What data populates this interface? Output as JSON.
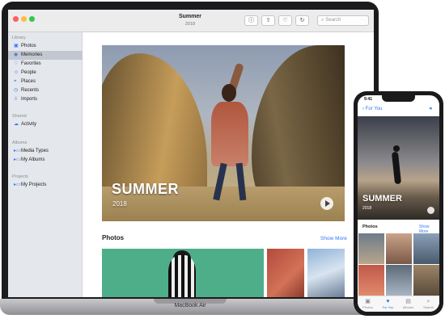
{
  "laptop": {
    "brand_label": "MacBook Air",
    "window": {
      "title": "Summer",
      "subtitle": "2018",
      "search_placeholder": "Search"
    },
    "sidebar": {
      "sections": [
        {
          "label": "Library",
          "items": [
            {
              "label": "Photos",
              "icon": "photos-icon",
              "selected": false
            },
            {
              "label": "Memories",
              "icon": "memories-icon",
              "selected": true
            },
            {
              "label": "Favorites",
              "icon": "heart-icon",
              "selected": false
            },
            {
              "label": "People",
              "icon": "people-icon",
              "selected": false
            },
            {
              "label": "Places",
              "icon": "places-icon",
              "selected": false
            },
            {
              "label": "Recents",
              "icon": "clock-icon",
              "selected": false
            },
            {
              "label": "Imports",
              "icon": "import-icon",
              "selected": false
            }
          ]
        },
        {
          "label": "Shared",
          "items": [
            {
              "label": "Activity",
              "icon": "cloud-icon",
              "selected": false
            }
          ]
        },
        {
          "label": "Albums",
          "items": [
            {
              "label": "Media Types",
              "icon": "folder-icon",
              "selected": false
            },
            {
              "label": "My Albums",
              "icon": "folder-icon",
              "selected": false
            }
          ]
        },
        {
          "label": "Projects",
          "items": [
            {
              "label": "My Projects",
              "icon": "folder-icon",
              "selected": false
            }
          ]
        }
      ]
    },
    "hero": {
      "title": "SUMMER",
      "year": "2018"
    },
    "photos_section": {
      "title": "Photos",
      "show_more": "Show More"
    }
  },
  "phone": {
    "status_time": "9:41",
    "back_label": "For You",
    "hero": {
      "title": "SUMMER",
      "year": "2018"
    },
    "photos_section": {
      "title": "Photos",
      "show_more": "Show More"
    },
    "tabs": [
      {
        "label": "Photos",
        "active": false
      },
      {
        "label": "For You",
        "active": true
      },
      {
        "label": "Albums",
        "active": false
      },
      {
        "label": "Search",
        "active": false
      }
    ]
  }
}
